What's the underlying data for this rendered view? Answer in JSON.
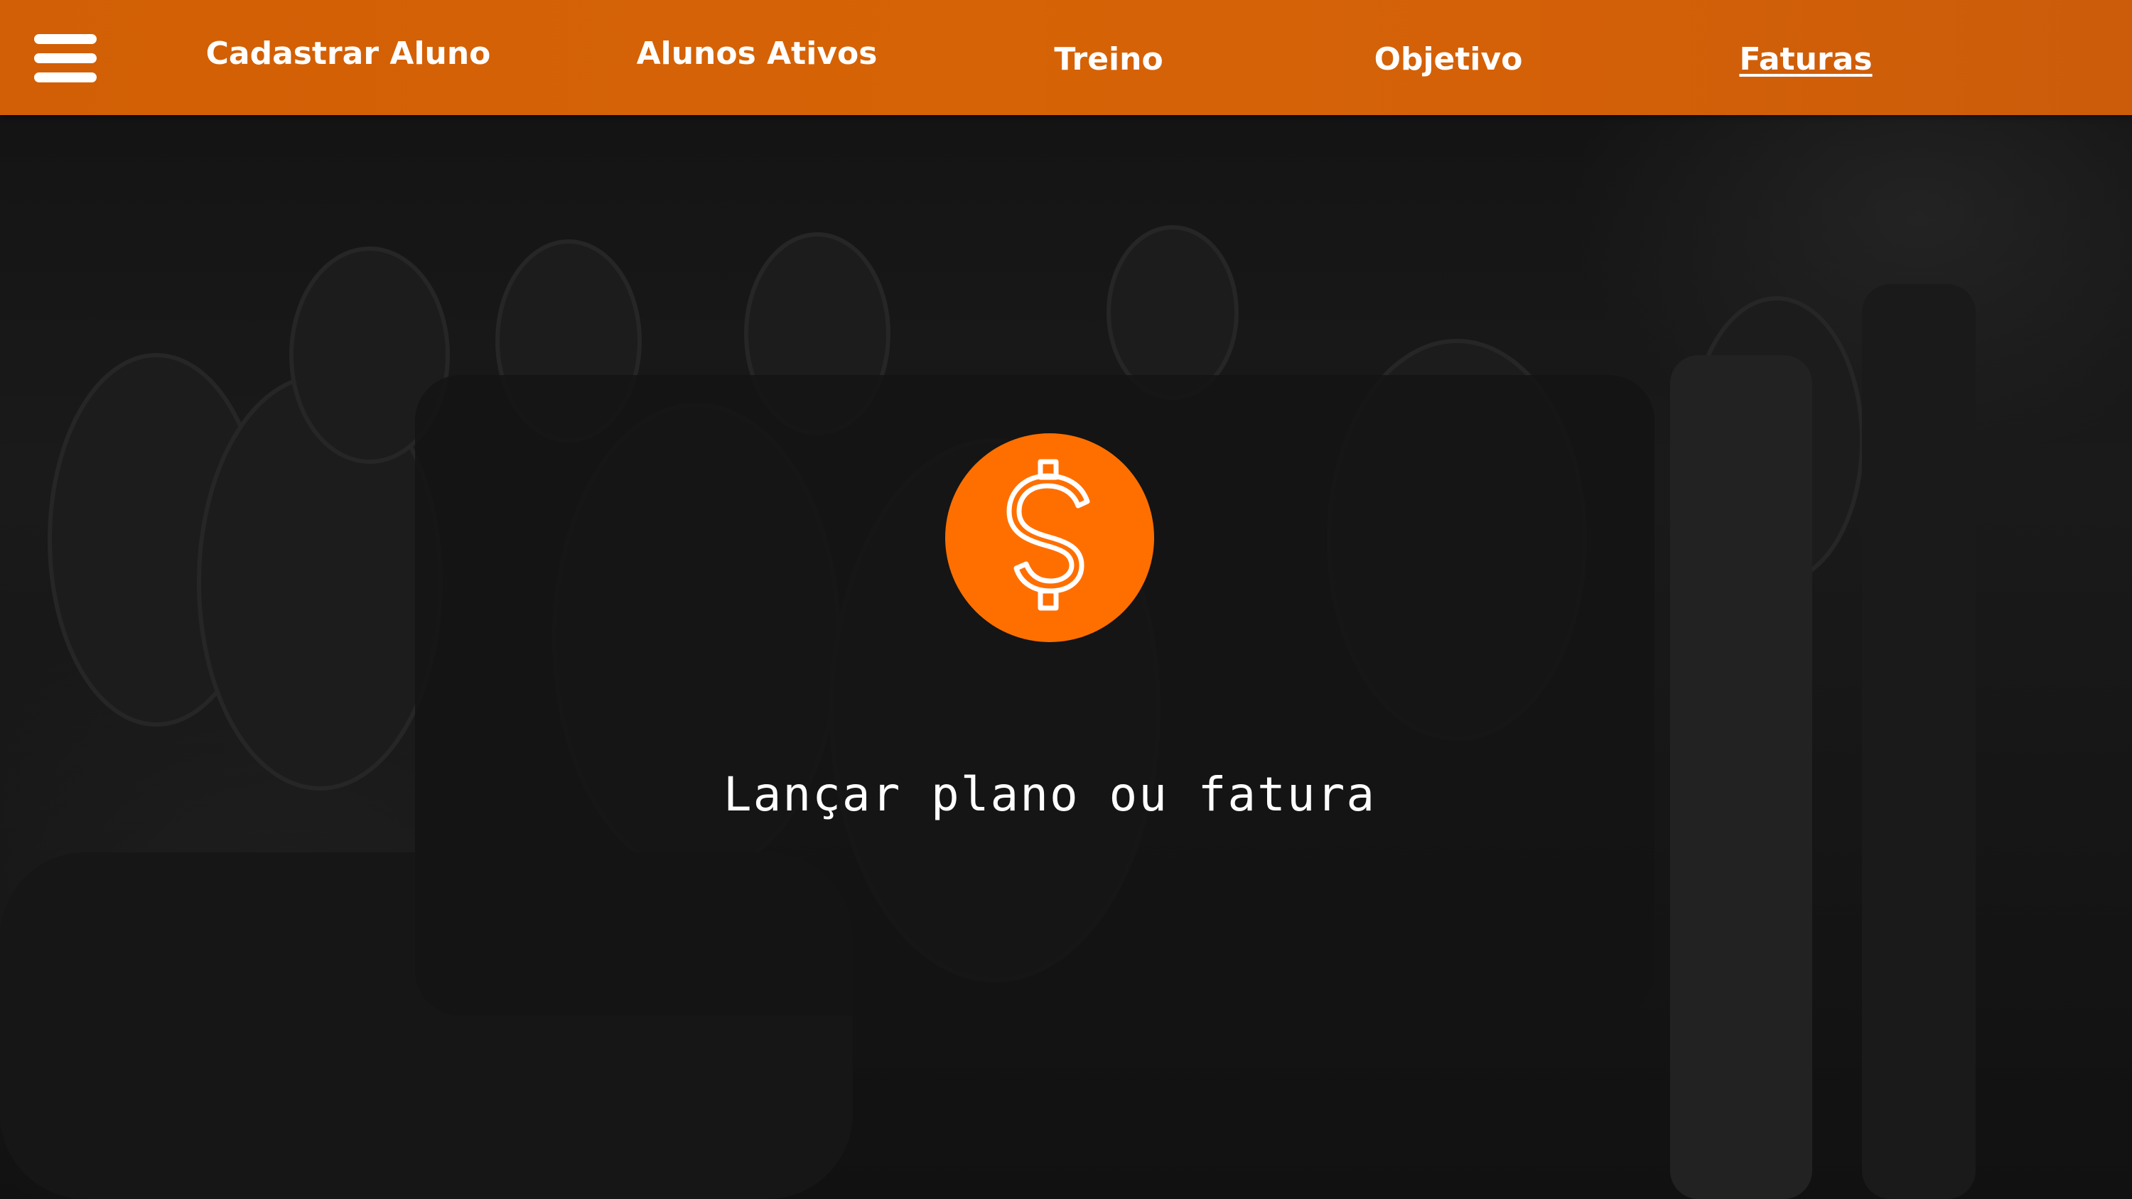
{
  "nav": {
    "menu_icon": "hamburger-menu-icon",
    "items": [
      {
        "label": "Cadastrar Aluno",
        "active": false
      },
      {
        "label": "Alunos Ativos",
        "active": false
      },
      {
        "label": "Treino",
        "active": false
      },
      {
        "label": "Objetivo",
        "active": false
      },
      {
        "label": "Faturas",
        "active": true
      }
    ]
  },
  "main": {
    "card": {
      "icon": "dollar-sign-icon",
      "label": "Lançar plano ou fatura"
    }
  },
  "colors": {
    "nav_bg": "#d46108",
    "accent": "#ff6f00",
    "text": "#ffffff",
    "card_bg": "#141414"
  }
}
